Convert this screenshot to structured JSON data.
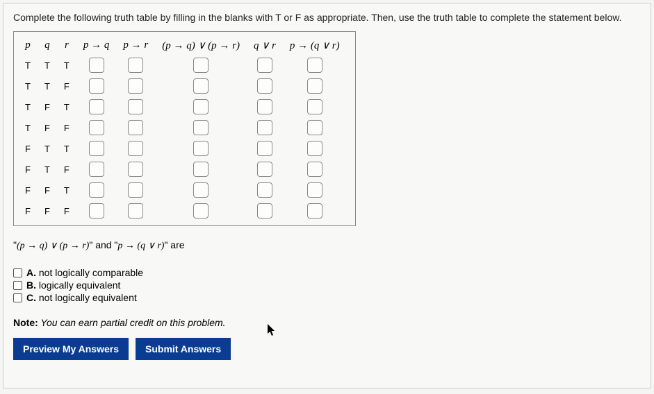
{
  "instruction": "Complete the following truth table by filling in the blanks with T or F as appropriate. Then, use the truth table to complete the statement below.",
  "headers": {
    "p": "p",
    "q": "q",
    "r": "r",
    "pq": "p → q",
    "pr": "p → r",
    "pqvpr": "(p → q) ∨ (p → r)",
    "qvr": "q ∨ r",
    "pqvr": "p → (q ∨ r)"
  },
  "rows": [
    {
      "p": "T",
      "q": "T",
      "r": "T"
    },
    {
      "p": "T",
      "q": "T",
      "r": "F"
    },
    {
      "p": "T",
      "q": "F",
      "r": "T"
    },
    {
      "p": "T",
      "q": "F",
      "r": "F"
    },
    {
      "p": "F",
      "q": "T",
      "r": "T"
    },
    {
      "p": "F",
      "q": "T",
      "r": "F"
    },
    {
      "p": "F",
      "q": "F",
      "r": "T"
    },
    {
      "p": "F",
      "q": "F",
      "r": "F"
    }
  ],
  "statement": {
    "open_quote": "\"",
    "expr1": "(p → q) ∨ (p → r)",
    "mid": "\" and \"",
    "expr2": "p → (q ∨ r)",
    "close": "\" are"
  },
  "options": {
    "a_label": "A.",
    "a_text": " not logically comparable",
    "b_label": "B.",
    "b_text": " logically equivalent",
    "c_label": "C.",
    "c_text": " not logically equivalent"
  },
  "note": {
    "prefix": "Note:",
    "text": " You can earn partial credit on this problem."
  },
  "buttons": {
    "preview": "Preview My Answers",
    "submit": "Submit Answers"
  }
}
